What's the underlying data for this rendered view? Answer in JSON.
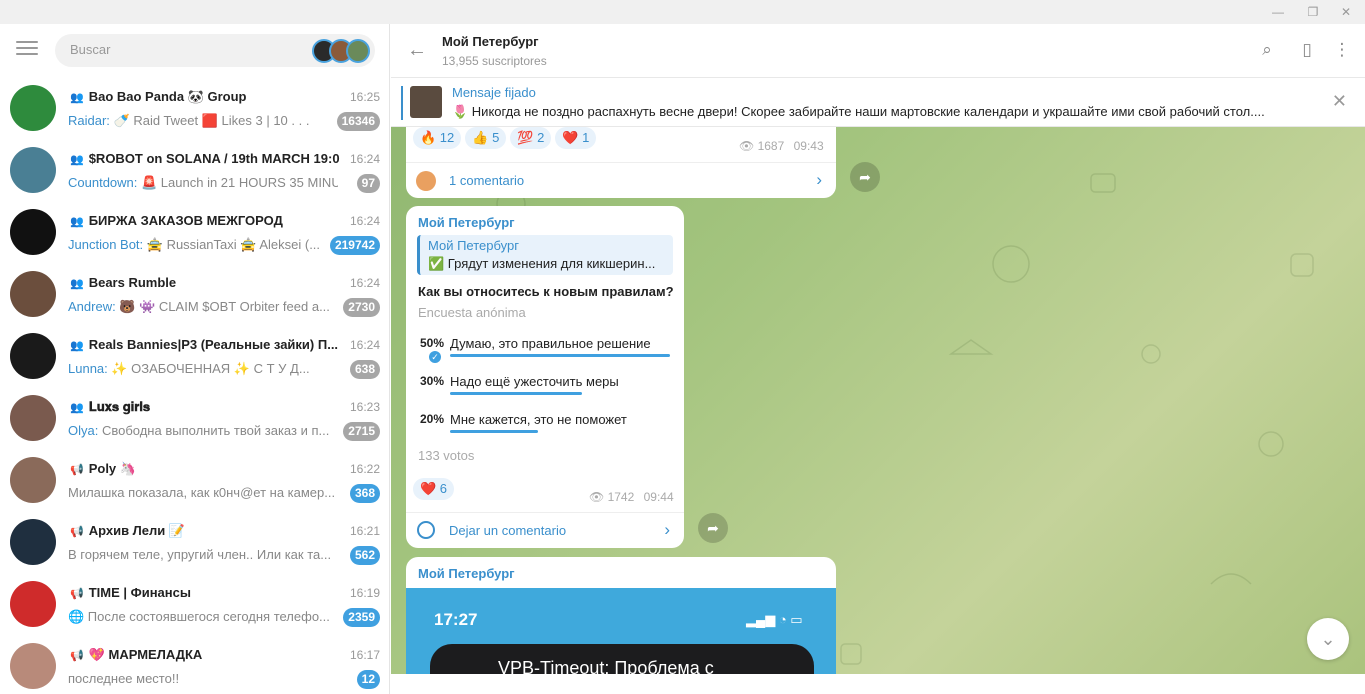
{
  "search": {
    "placeholder": "Buscar"
  },
  "chats": [
    {
      "title": "Bao Bao Panda 🐼 Group",
      "type": "group",
      "time": "16:25",
      "sender": "Raidar:",
      "preview": " 🍼 Raid Tweet 🟥 Likes 3 | 10 . . .",
      "badge": "16346",
      "badge_color": "gray",
      "avatar_color": "#2e8b3d"
    },
    {
      "title": "$ROBOT on SOLANA / 19th MARCH 19:0...",
      "type": "group",
      "time": "16:24",
      "sender": "Countdown:",
      "preview": " 🚨 Launch in 21 HOURS 35 MINU...",
      "badge": "97",
      "badge_color": "gray",
      "avatar_color": "#4a7f94"
    },
    {
      "title": "БИРЖА ЗАКАЗОВ МЕЖГОРОД",
      "type": "group",
      "time": "16:24",
      "sender": "Junction Bot:",
      "preview": " 🚖 RussianTaxi 🚖 Aleksei (...",
      "badge": "219742",
      "badge_color": "blue",
      "avatar_color": "#111111"
    },
    {
      "title": "Bears Rumble",
      "type": "group",
      "time": "16:24",
      "sender": "Andrew:",
      "preview": " 🐻 👾 CLAIM $OBT  Orbiter feed a...",
      "badge": "2730",
      "badge_color": "gray",
      "avatar_color": "#6b4e3d"
    },
    {
      "title": "Reals Bannies|P3 (Реальные зайки) П...",
      "type": "group",
      "time": "16:24",
      "sender": "Lunna:",
      "preview": " ✨ ОЗАБОЧЕННАЯ ✨ С Т У Д...",
      "badge": "638",
      "badge_color": "gray",
      "avatar_color": "#1a1a1a"
    },
    {
      "title": "𝐋𝐮𝐱𝐬 𝐠𝐢𝐫𝐥𝐬",
      "type": "group",
      "time": "16:23",
      "sender": "Olya:",
      "preview": " Свободна выполнить твой заказ и п...",
      "badge": "2715",
      "badge_color": "gray",
      "avatar_color": "#7a5a4e"
    },
    {
      "title": "Poly 🦄",
      "type": "channel",
      "time": "16:22",
      "sender": "",
      "preview": "Милашка показала, как к0нч@ет на камер...",
      "badge": "368",
      "badge_color": "blue",
      "avatar_color": "#8a6a5a"
    },
    {
      "title": "Архив Лели 📝",
      "type": "channel",
      "time": "16:21",
      "sender": "",
      "preview": "В горячем теле, упругий член.. Или как та...",
      "badge": "562",
      "badge_color": "blue",
      "avatar_color": "#1f2f3f"
    },
    {
      "title": "TIME | Финансы",
      "type": "channel",
      "time": "16:19",
      "sender": "",
      "preview": "🌐 После состоявшегося сегодня телефо...",
      "badge": "2359",
      "badge_color": "blue",
      "avatar_color": "#cf2b2b"
    },
    {
      "title": "💖 МАРМЕЛАДКА",
      "type": "channel",
      "time": "16:17",
      "sender": "",
      "preview": "последнее место!!",
      "badge": "12",
      "badge_color": "blue",
      "avatar_color": "#b88a7a"
    }
  ],
  "channel": {
    "title": "Мой Петербург",
    "subscribers": "13,955 suscriptores"
  },
  "pinned": {
    "title": "Mensaje fijado",
    "text": "🌷 Никогда не поздно распахнуть весне двери!  Скорее забирайте наши мартовские календари и украшайте ими свой рабочий стол...."
  },
  "message1": {
    "reactions": [
      "🔥 12",
      "👍 5",
      "💯 2",
      "❤️ 1"
    ],
    "views": "1687",
    "time": "09:43",
    "comments": "1 comentario"
  },
  "message2": {
    "author": "Мой Петербург",
    "reply_author": "Мой Петербург",
    "reply_text": "✅ Грядут изменения для кикшерин...",
    "question": "Как вы относитесь к новым правилам?",
    "poll_type": "Encuesta anónima",
    "options": [
      {
        "pct": "50%",
        "label": "Думаю, это правильное решение",
        "value": 50
      },
      {
        "pct": "30%",
        "label": "Надо ещё ужесточить меры",
        "value": 30
      },
      {
        "pct": "20%",
        "label": "Мне кажется, это не поможет",
        "value": 20
      }
    ],
    "votes": "133 votos",
    "reaction": "❤️ 6",
    "views": "1742",
    "time": "09:44",
    "comments": "Dejar un comentario"
  },
  "message3": {
    "author": "Мой Петербург",
    "phone_time": "17:27",
    "phone_text": "VPB-Timeout: Проблема с"
  },
  "colors": {
    "accent": "#3a8fcc",
    "badge_blue": "#3fa0e0",
    "badge_gray": "#a6a6a6"
  }
}
